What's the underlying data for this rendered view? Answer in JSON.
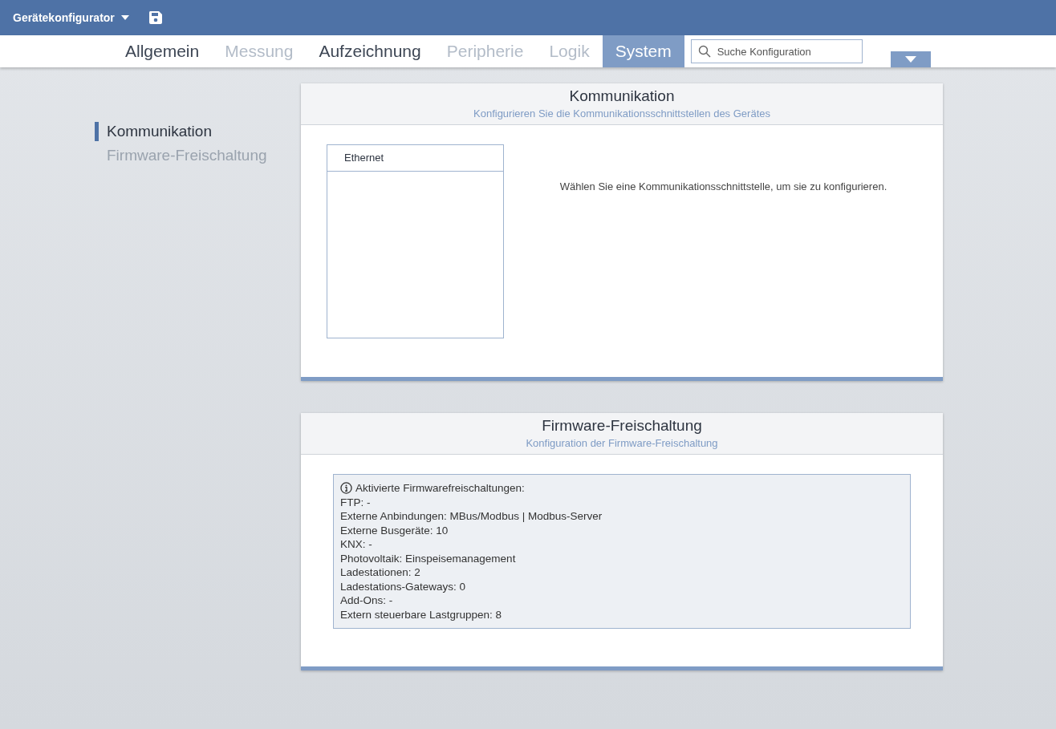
{
  "app": {
    "title": "Gerätekonfigurator"
  },
  "tabs": [
    {
      "label": "Allgemein",
      "selected": false,
      "disabled": false
    },
    {
      "label": "Messung",
      "selected": false,
      "disabled": true
    },
    {
      "label": "Aufzeichnung",
      "selected": false,
      "disabled": false
    },
    {
      "label": "Peripherie",
      "selected": false,
      "disabled": true
    },
    {
      "label": "Logik",
      "selected": false,
      "disabled": true
    },
    {
      "label": "System",
      "selected": true,
      "disabled": false
    }
  ],
  "search": {
    "placeholder": "Suche Konfiguration"
  },
  "sidebar": {
    "items": [
      {
        "label": "Kommunikation",
        "selected": true
      },
      {
        "label": "Firmware-Freischaltung",
        "selected": false
      }
    ]
  },
  "communication": {
    "title": "Kommunikation",
    "subtitle": "Konfigurieren Sie die Kommunikationsschnittstellen des Gerätes",
    "interfaces": [
      {
        "label": "Ethernet",
        "selected": false
      }
    ],
    "hint": "Wählen Sie eine Kommunikationsschnittstelle, um sie zu konfigurieren."
  },
  "firmware": {
    "title": "Firmware-Freischaltung",
    "subtitle": "Konfiguration der Firmware-Freischaltung",
    "heading": "Aktivierte Firmwarefreischaltungen:",
    "lines": [
      "FTP: -",
      "Externe Anbindungen: MBus/Modbus | Modbus-Server",
      "Externe Busgeräte: 10",
      "KNX: -",
      "Photovoltaik: Einspeisemanagement",
      "Ladestationen: 2",
      "Ladestations-Gateways: 0",
      "Add-Ons: -",
      "Extern steuerbare Lastgruppen: 8"
    ]
  }
}
